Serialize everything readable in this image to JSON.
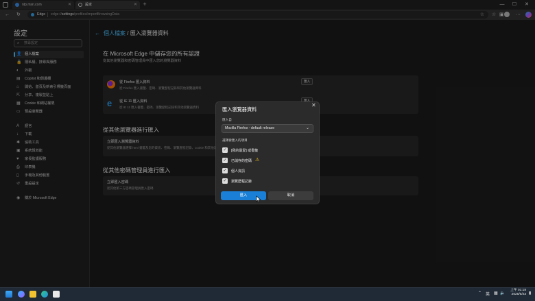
{
  "browser": {
    "tab1_title": "ntp.msn.com",
    "tab2_title": "設定",
    "address_label": "Edge",
    "address_host": "edge://",
    "address_strong": "settings",
    "address_path": "/profiles/importBrowsingData"
  },
  "sidebar": {
    "title": "設定",
    "search_placeholder": "搜尋設定",
    "items": [
      {
        "label": "個人檔案",
        "icon": "profile-icon",
        "glyph": "👤",
        "active": true
      },
      {
        "label": "隱私權、搜尋與服務",
        "icon": "lock-icon",
        "glyph": "🔒"
      },
      {
        "label": "外觀",
        "icon": "appearance-icon",
        "glyph": "◐"
      },
      {
        "label": "Copilot 和側邊欄",
        "icon": "copilot-icon",
        "glyph": "▤"
      },
      {
        "label": "開始、首頁及新索引標籤頁面",
        "icon": "home-icon",
        "glyph": "⌂"
      },
      {
        "label": "分享、複製並貼上",
        "icon": "share-icon",
        "glyph": "⇱"
      },
      {
        "label": "Cookie 和網站權限",
        "icon": "cookie-icon",
        "glyph": "▦"
      },
      {
        "label": "預設瀏覽器",
        "icon": "browser-icon",
        "glyph": "▭"
      },
      {
        "label": "語言",
        "icon": "language-icon",
        "glyph": "A"
      },
      {
        "label": "下載",
        "icon": "download-icon",
        "glyph": "↓"
      },
      {
        "label": "協助工具",
        "icon": "accessibility-icon",
        "glyph": "✱"
      },
      {
        "label": "系統與效能",
        "icon": "system-icon",
        "glyph": "▣"
      },
      {
        "label": "家長監護服務",
        "icon": "family-icon",
        "glyph": "♥"
      },
      {
        "label": "印表機",
        "icon": "printer-icon",
        "glyph": "⎙"
      },
      {
        "label": "手機及其他裝置",
        "icon": "phone-icon",
        "glyph": "▯"
      },
      {
        "label": "重設設定",
        "icon": "reset-icon",
        "glyph": "↺"
      },
      {
        "label": "關於 Microsoft Edge",
        "icon": "edge-logo-icon",
        "glyph": "◉"
      }
    ]
  },
  "main": {
    "breadcrumb_parent": "個人檔案",
    "breadcrumb_sep": "/",
    "breadcrumb_current": "匯入瀏覽器資料",
    "section1_title": "在 Microsoft Edge 中儲存您的所有認證",
    "section1_sub": "從其他瀏覽器和密碼管理員中匯入您的瀏覽器資料",
    "firefox_title": "從 Firefox 匯入資料",
    "firefox_sub": "從 Firefox 匯入書籤、密碼、瀏覽歷程記錄和其他瀏覽器資料",
    "ie_title": "從 IE 11 匯入資料",
    "ie_sub": "從 IE 11 匯入書籤、密碼、瀏覽歷程記錄和其他瀏覽器資料",
    "import_label": "匯入",
    "section2_title": "從其他瀏覽器進行匯入",
    "other_title": "立即匯入瀏覽器資料",
    "other_sub": "從其他瀏覽器選擇 html 書籤及您的資訊、密碼、瀏覽歷程記錄、cookie 和其他瀏覽器資料",
    "section3_title": "從其他密碼管理員進行匯入",
    "pw_title": "立即匯入密碼",
    "pw_sub": "從其他第三方密碼管理員匯入密碼"
  },
  "dialog": {
    "title": "匯入瀏覽器資料",
    "from_label": "匯入自",
    "selected": "Mozilla Firefox - default release",
    "choose_label": "選擇要匯入的項目",
    "items": [
      {
        "label": "[我的最愛] 或書籤",
        "checked": true
      },
      {
        "label": "已儲存的密碼",
        "checked": true
      },
      {
        "label": "個人資訊",
        "checked": true
      },
      {
        "label": "瀏覽歷程記錄",
        "checked": true
      }
    ],
    "import_button": "匯入",
    "cancel_button": "取消"
  },
  "taskbar": {
    "lang": "英",
    "time": "上午 01:18",
    "date": "2025/6/23"
  },
  "colors": {
    "accent": "#4cc2ff",
    "primary_button": "#1a7fd6",
    "warning": "#f5c518"
  }
}
